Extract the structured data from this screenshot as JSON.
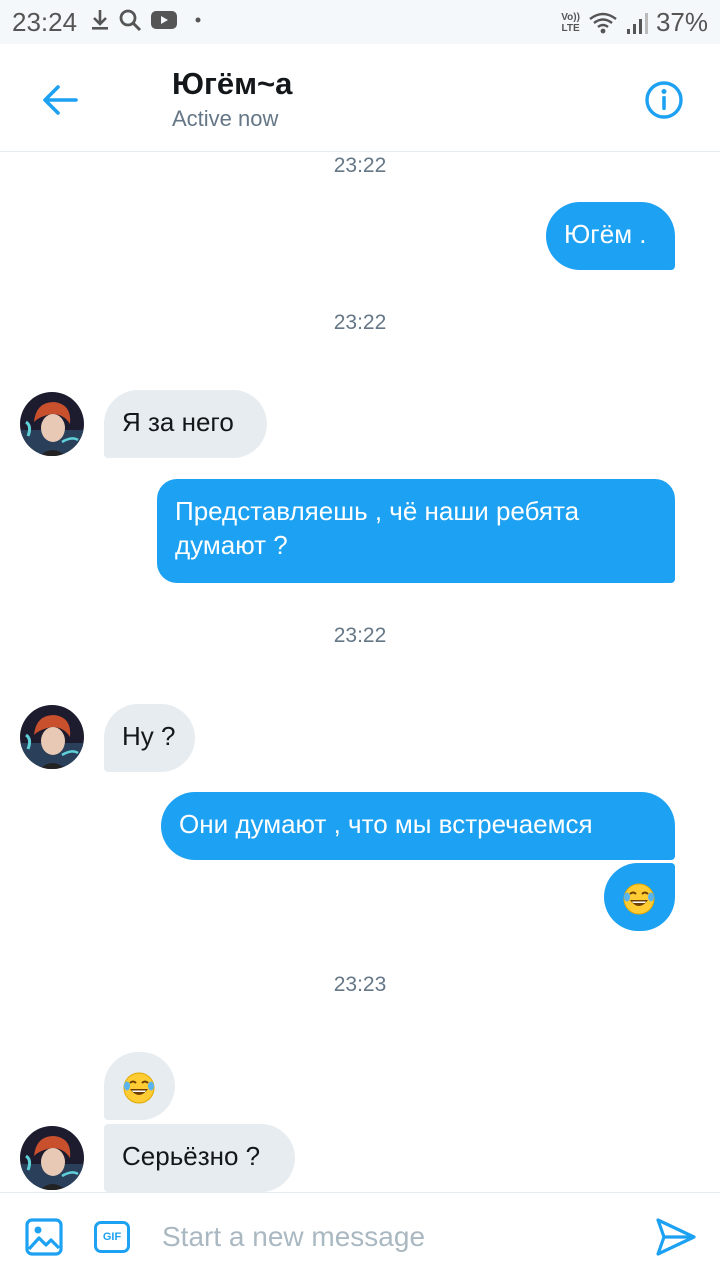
{
  "status_bar": {
    "time": "23:24",
    "volte_top": "Vo))",
    "volte_bottom": "LTE",
    "battery": "37%"
  },
  "header": {
    "title": "Югём~а",
    "subtitle": "Active now"
  },
  "timestamps": [
    "23:22",
    "23:22",
    "23:22",
    "23:23"
  ],
  "messages": [
    {
      "side": "out",
      "text": "Югём ."
    },
    {
      "side": "in",
      "text": "Я за него"
    },
    {
      "side": "out",
      "text": "Представляешь , чё наши ребята думают ?"
    },
    {
      "side": "in",
      "text": "Ну ?"
    },
    {
      "side": "out",
      "text": "Они думают , что мы встречаемся"
    },
    {
      "side": "out",
      "emoji": "tears-of-joy-emoji"
    },
    {
      "side": "in",
      "emoji": "tears-of-joy-emoji"
    },
    {
      "side": "in",
      "text": "Серьёзно ?"
    }
  ],
  "composer": {
    "placeholder": "Start a new message",
    "gif_label": "GIF"
  },
  "colors": {
    "accent": "#1da1f2",
    "incoming_bubble": "#e6ecf0",
    "muted_text": "#657786"
  }
}
